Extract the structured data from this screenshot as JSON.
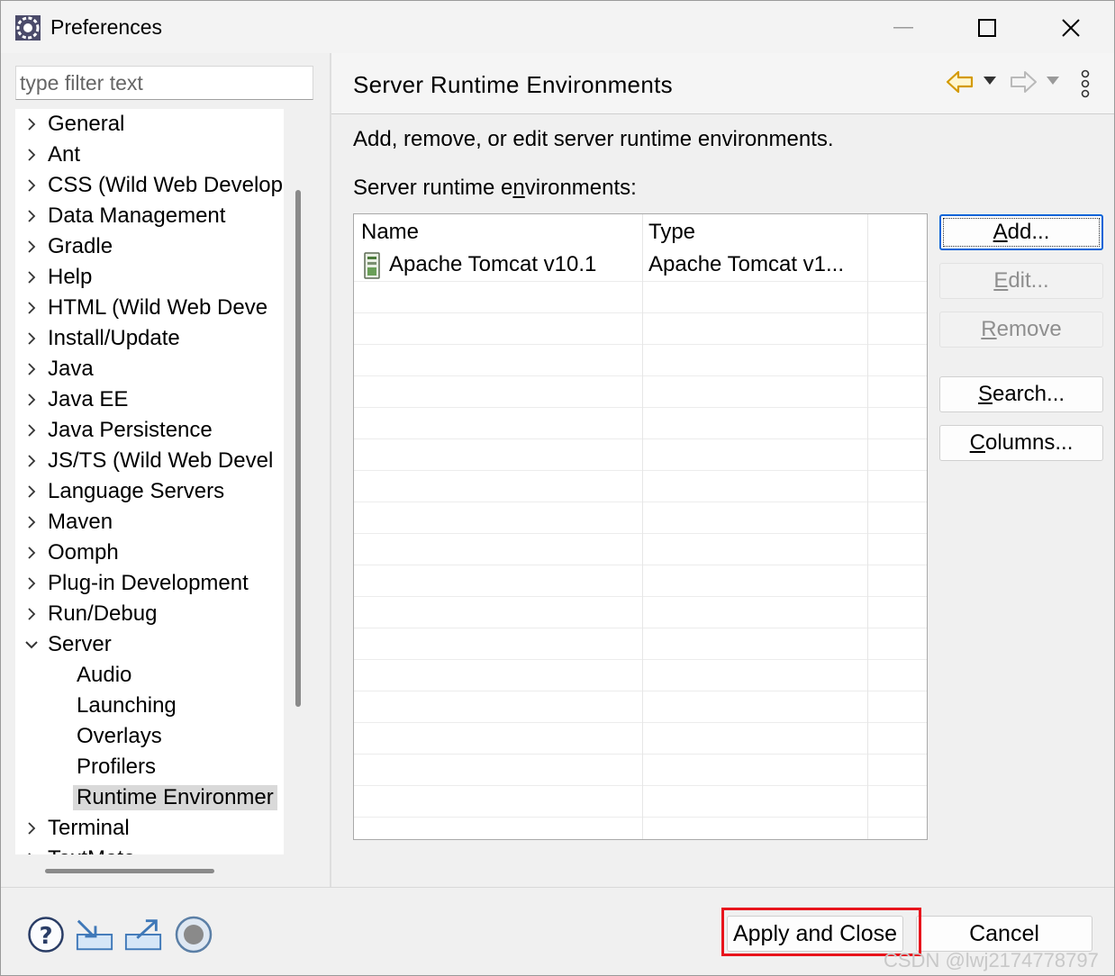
{
  "window": {
    "title": "Preferences"
  },
  "filter": {
    "placeholder": "type filter text"
  },
  "tree": {
    "items": [
      {
        "label": "General",
        "state": "collapsed"
      },
      {
        "label": "Ant",
        "state": "collapsed"
      },
      {
        "label": "CSS (Wild Web Develop",
        "state": "collapsed"
      },
      {
        "label": "Data Management",
        "state": "collapsed"
      },
      {
        "label": "Gradle",
        "state": "collapsed"
      },
      {
        "label": "Help",
        "state": "collapsed"
      },
      {
        "label": "HTML (Wild Web Deve",
        "state": "collapsed"
      },
      {
        "label": "Install/Update",
        "state": "collapsed"
      },
      {
        "label": "Java",
        "state": "collapsed"
      },
      {
        "label": "Java EE",
        "state": "collapsed"
      },
      {
        "label": "Java Persistence",
        "state": "collapsed"
      },
      {
        "label": "JS/TS (Wild Web Devel",
        "state": "collapsed"
      },
      {
        "label": "Language Servers",
        "state": "collapsed"
      },
      {
        "label": "Maven",
        "state": "collapsed"
      },
      {
        "label": "Oomph",
        "state": "collapsed"
      },
      {
        "label": "Plug-in Development",
        "state": "collapsed"
      },
      {
        "label": "Run/Debug",
        "state": "collapsed"
      },
      {
        "label": "Server",
        "state": "expanded"
      },
      {
        "label": "Audio",
        "state": "child"
      },
      {
        "label": "Launching",
        "state": "child"
      },
      {
        "label": "Overlays",
        "state": "child"
      },
      {
        "label": "Profilers",
        "state": "child"
      },
      {
        "label": "Runtime Environmer",
        "state": "child-selected"
      },
      {
        "label": "Terminal",
        "state": "collapsed"
      },
      {
        "label": "TextMate",
        "state": "collapsed"
      }
    ]
  },
  "page": {
    "title": "Server Runtime Environments",
    "description": "Add, remove, or edit server runtime environments.",
    "list_label_pre": "Server runtime e",
    "list_label_mnemonic": "n",
    "list_label_post": "vironments:"
  },
  "table": {
    "columns": [
      "Name",
      "Type"
    ],
    "rows": [
      {
        "name": "Apache Tomcat v10.1",
        "type": "Apache Tomcat v1...",
        "icon": "server-icon"
      }
    ]
  },
  "buttons": {
    "add": {
      "mnemonic": "A",
      "rest": "dd..."
    },
    "edit": {
      "mnemonic": "E",
      "rest": "dit..."
    },
    "remove": {
      "mnemonic": "R",
      "rest": "emove"
    },
    "search": {
      "mnemonic": "S",
      "rest": "earch..."
    },
    "columns": {
      "mnemonic": "C",
      "rest": "olumns..."
    }
  },
  "footer": {
    "apply_close": "Apply and Close",
    "cancel": "Cancel",
    "icons": [
      "help-icon",
      "import-icon",
      "export-icon",
      "record-icon"
    ]
  },
  "watermark": "CSDN @lwj2174778797",
  "colors": {
    "highlight": "#e8141c",
    "default_button_border": "#0a64d8",
    "selection": "#d9d9d9"
  }
}
